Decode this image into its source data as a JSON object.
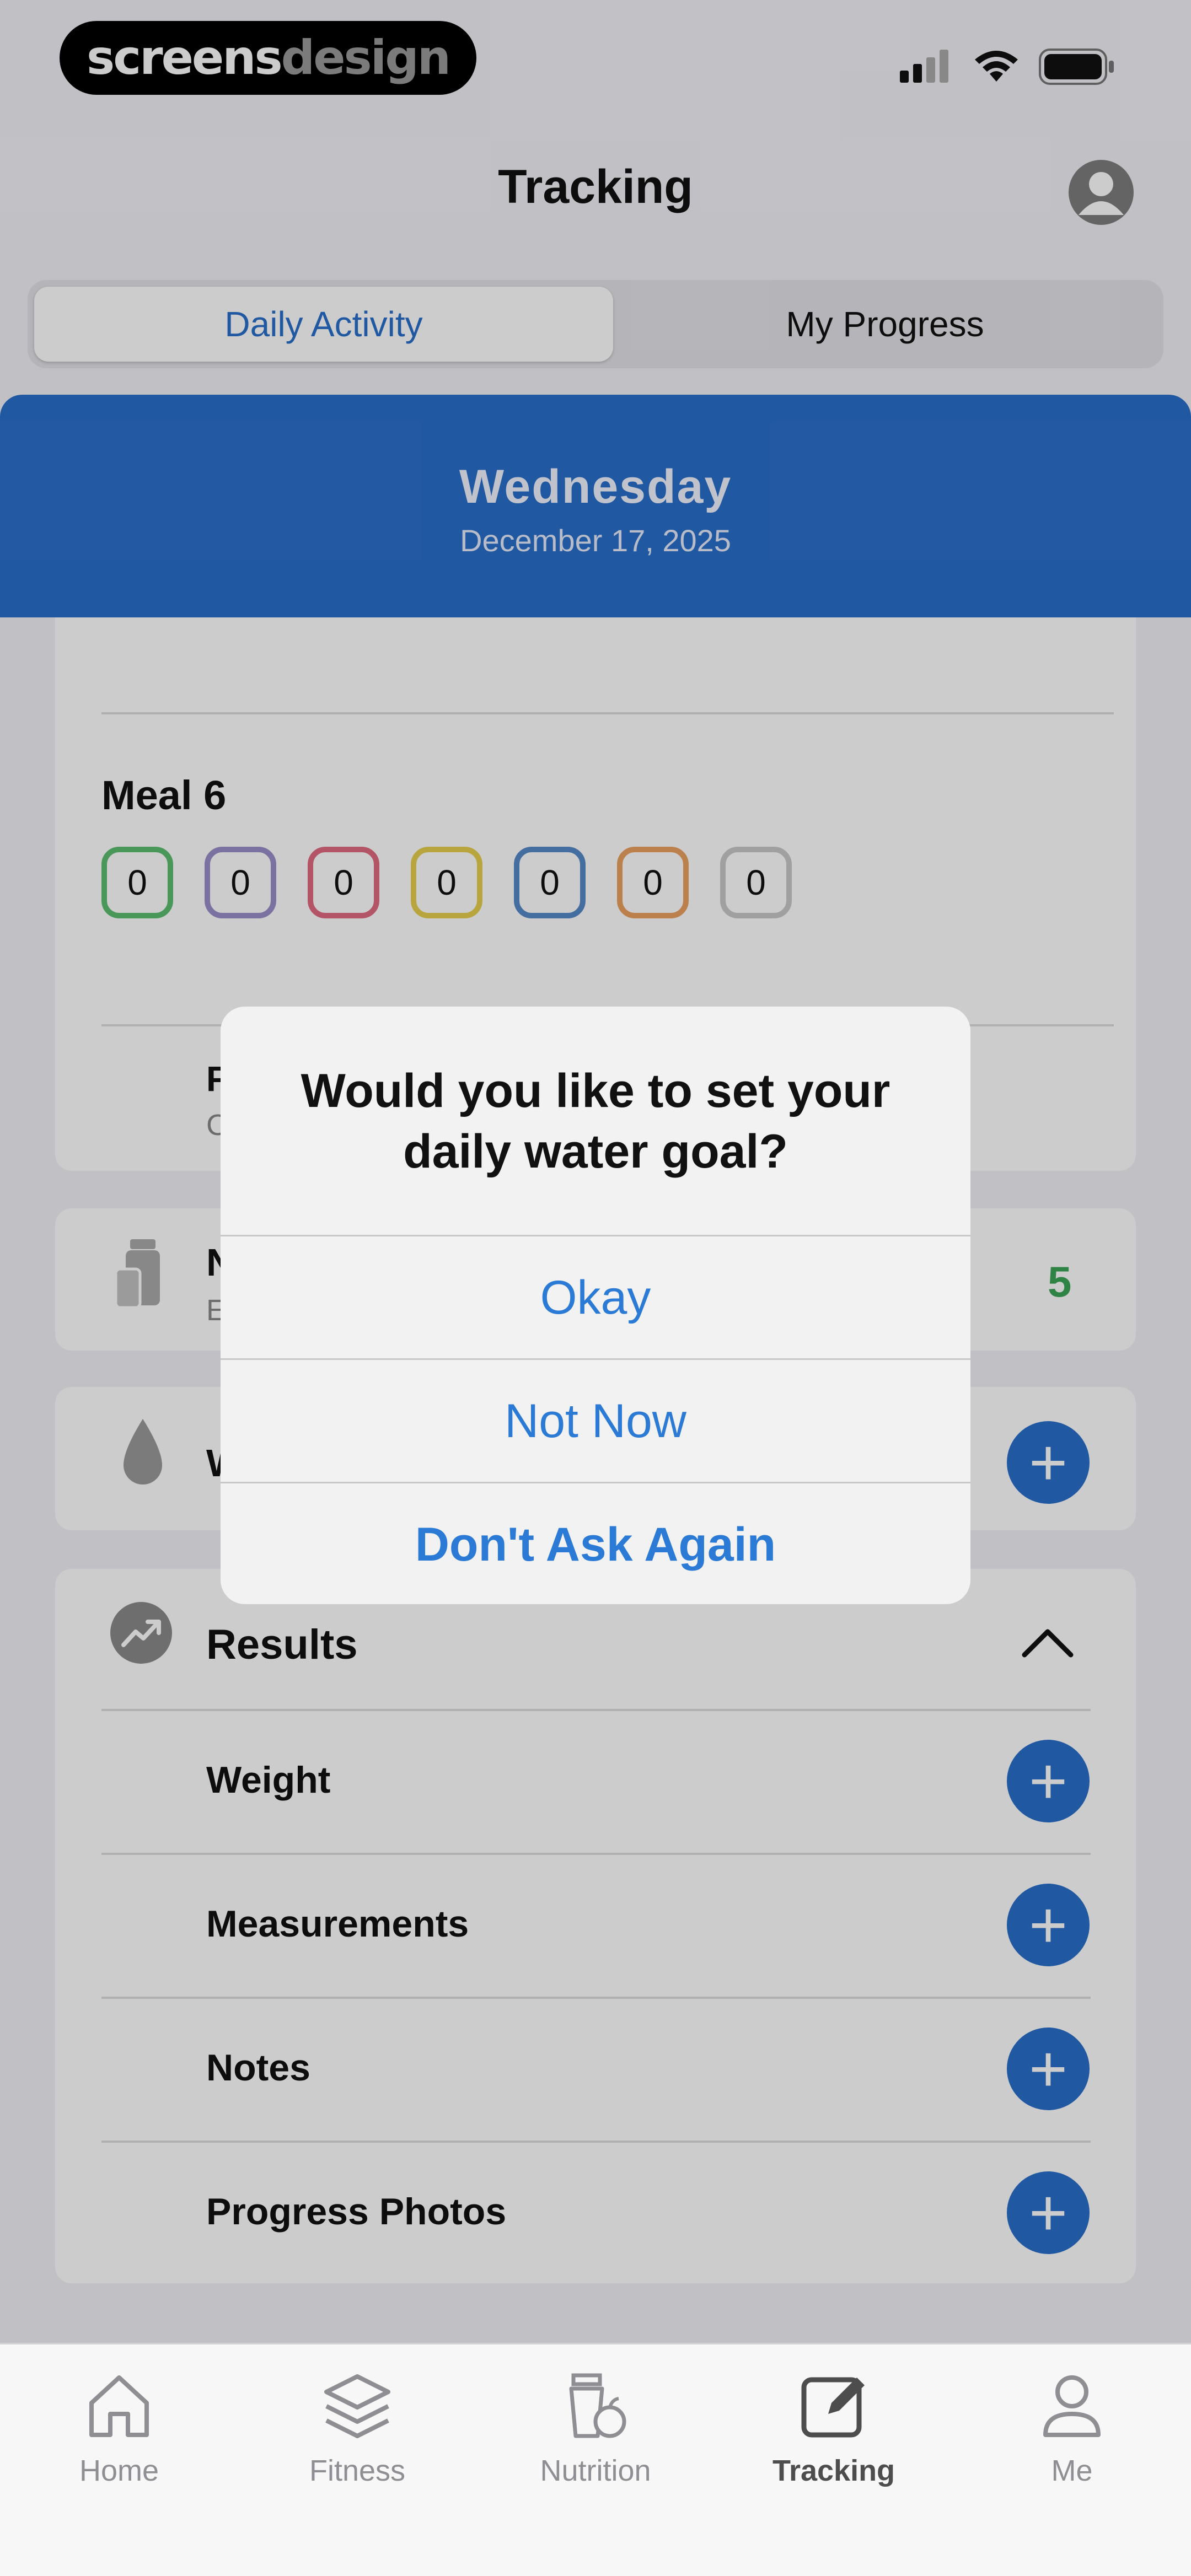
{
  "status_bar": {
    "brand_a": "screens",
    "brand_b": "design",
    "icons": [
      "cellular-signal-icon",
      "wifi-icon",
      "battery-icon"
    ]
  },
  "header": {
    "title": "Tracking",
    "profile_icon": "person-circle-icon"
  },
  "segments": {
    "daily": "Daily Activity",
    "progress": "My Progress",
    "selected": "Daily Activity"
  },
  "day": {
    "name": "Wednesday",
    "date": "December 17, 2025"
  },
  "meal": {
    "title": "Meal 6",
    "macros": [
      {
        "value": "0",
        "color": "#5cbd70"
      },
      {
        "value": "0",
        "color": "#9c8fcb"
      },
      {
        "value": "0",
        "color": "#e06b80"
      },
      {
        "value": "0",
        "color": "#e8cf4e"
      },
      {
        "value": "0",
        "color": "#5589c8"
      },
      {
        "value": "0",
        "color": "#eaa060"
      },
      {
        "value": "0",
        "color": "#c9c9c9"
      }
    ]
  },
  "partial_rows": {
    "row_a": {
      "title": "F",
      "subtitle": "C"
    },
    "row_b": {
      "title": "N",
      "subtitle": "E",
      "count": "5",
      "icon": "supplement-bottles-icon"
    },
    "row_c": {
      "title": "W",
      "icon": "water-drop-icon"
    }
  },
  "results": {
    "title": "Results",
    "icon": "trend-chart-icon",
    "items": [
      {
        "label": "Weight"
      },
      {
        "label": "Measurements"
      },
      {
        "label": "Notes"
      },
      {
        "label": "Progress Photos"
      }
    ]
  },
  "alert": {
    "message": "Would you like to set your daily water goal?",
    "okay": "Okay",
    "not_now": "Not Now",
    "dont_ask": "Don't Ask Again"
  },
  "tabbar": {
    "items": [
      {
        "label": "Home",
        "icon": "home-icon"
      },
      {
        "label": "Fitness",
        "icon": "layers-icon"
      },
      {
        "label": "Nutrition",
        "icon": "nutrition-icon"
      },
      {
        "label": "Tracking",
        "icon": "tracking-edit-icon"
      },
      {
        "label": "Me",
        "icon": "person-icon"
      }
    ],
    "selected": "Tracking"
  },
  "colors": {
    "accent": "#2a6fcb",
    "alert_button": "#2a7ad6",
    "count_green": "#3aa457"
  }
}
